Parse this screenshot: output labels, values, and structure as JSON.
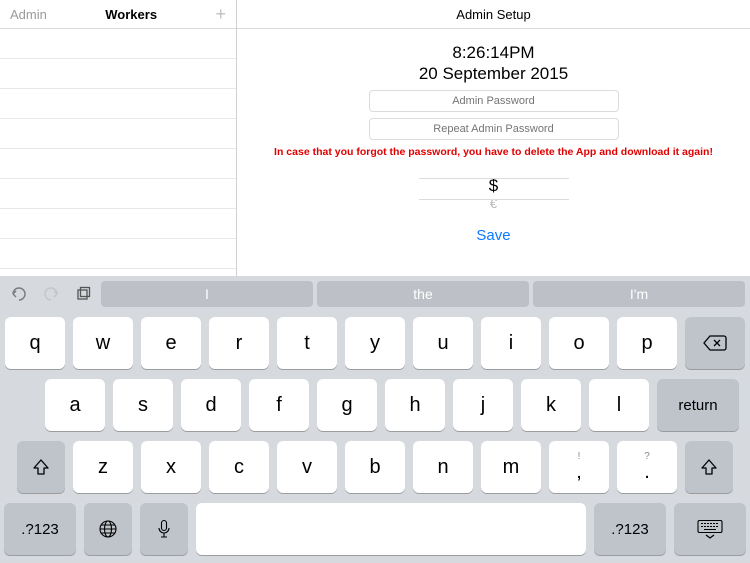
{
  "sidebar": {
    "back_label": "Admin",
    "title": "Workers",
    "add_label": "+"
  },
  "main": {
    "title": "Admin Setup",
    "time": "8:26:14PM",
    "date": "20 September 2015",
    "password_placeholder": "Admin Password",
    "repeat_placeholder": "Repeat Admin Password",
    "warning": "In case that you forgot the password, you have to delete the App and download it again!",
    "currency": {
      "selected": "$",
      "below": "€"
    },
    "save_label": "Save"
  },
  "keyboard": {
    "suggestions": [
      "I",
      "the",
      "I'm"
    ],
    "rows": [
      [
        "q",
        "w",
        "e",
        "r",
        "t",
        "y",
        "u",
        "i",
        "o",
        "p"
      ],
      [
        "a",
        "s",
        "d",
        "f",
        "g",
        "h",
        "j",
        "k",
        "l"
      ],
      [
        "z",
        "x",
        "c",
        "v",
        "b",
        "n",
        "m",
        ",",
        "."
      ]
    ],
    "punct_alt": {
      "comma": "!",
      "period": "?"
    },
    "return_label": "return",
    "numsym_label": ".?123"
  }
}
